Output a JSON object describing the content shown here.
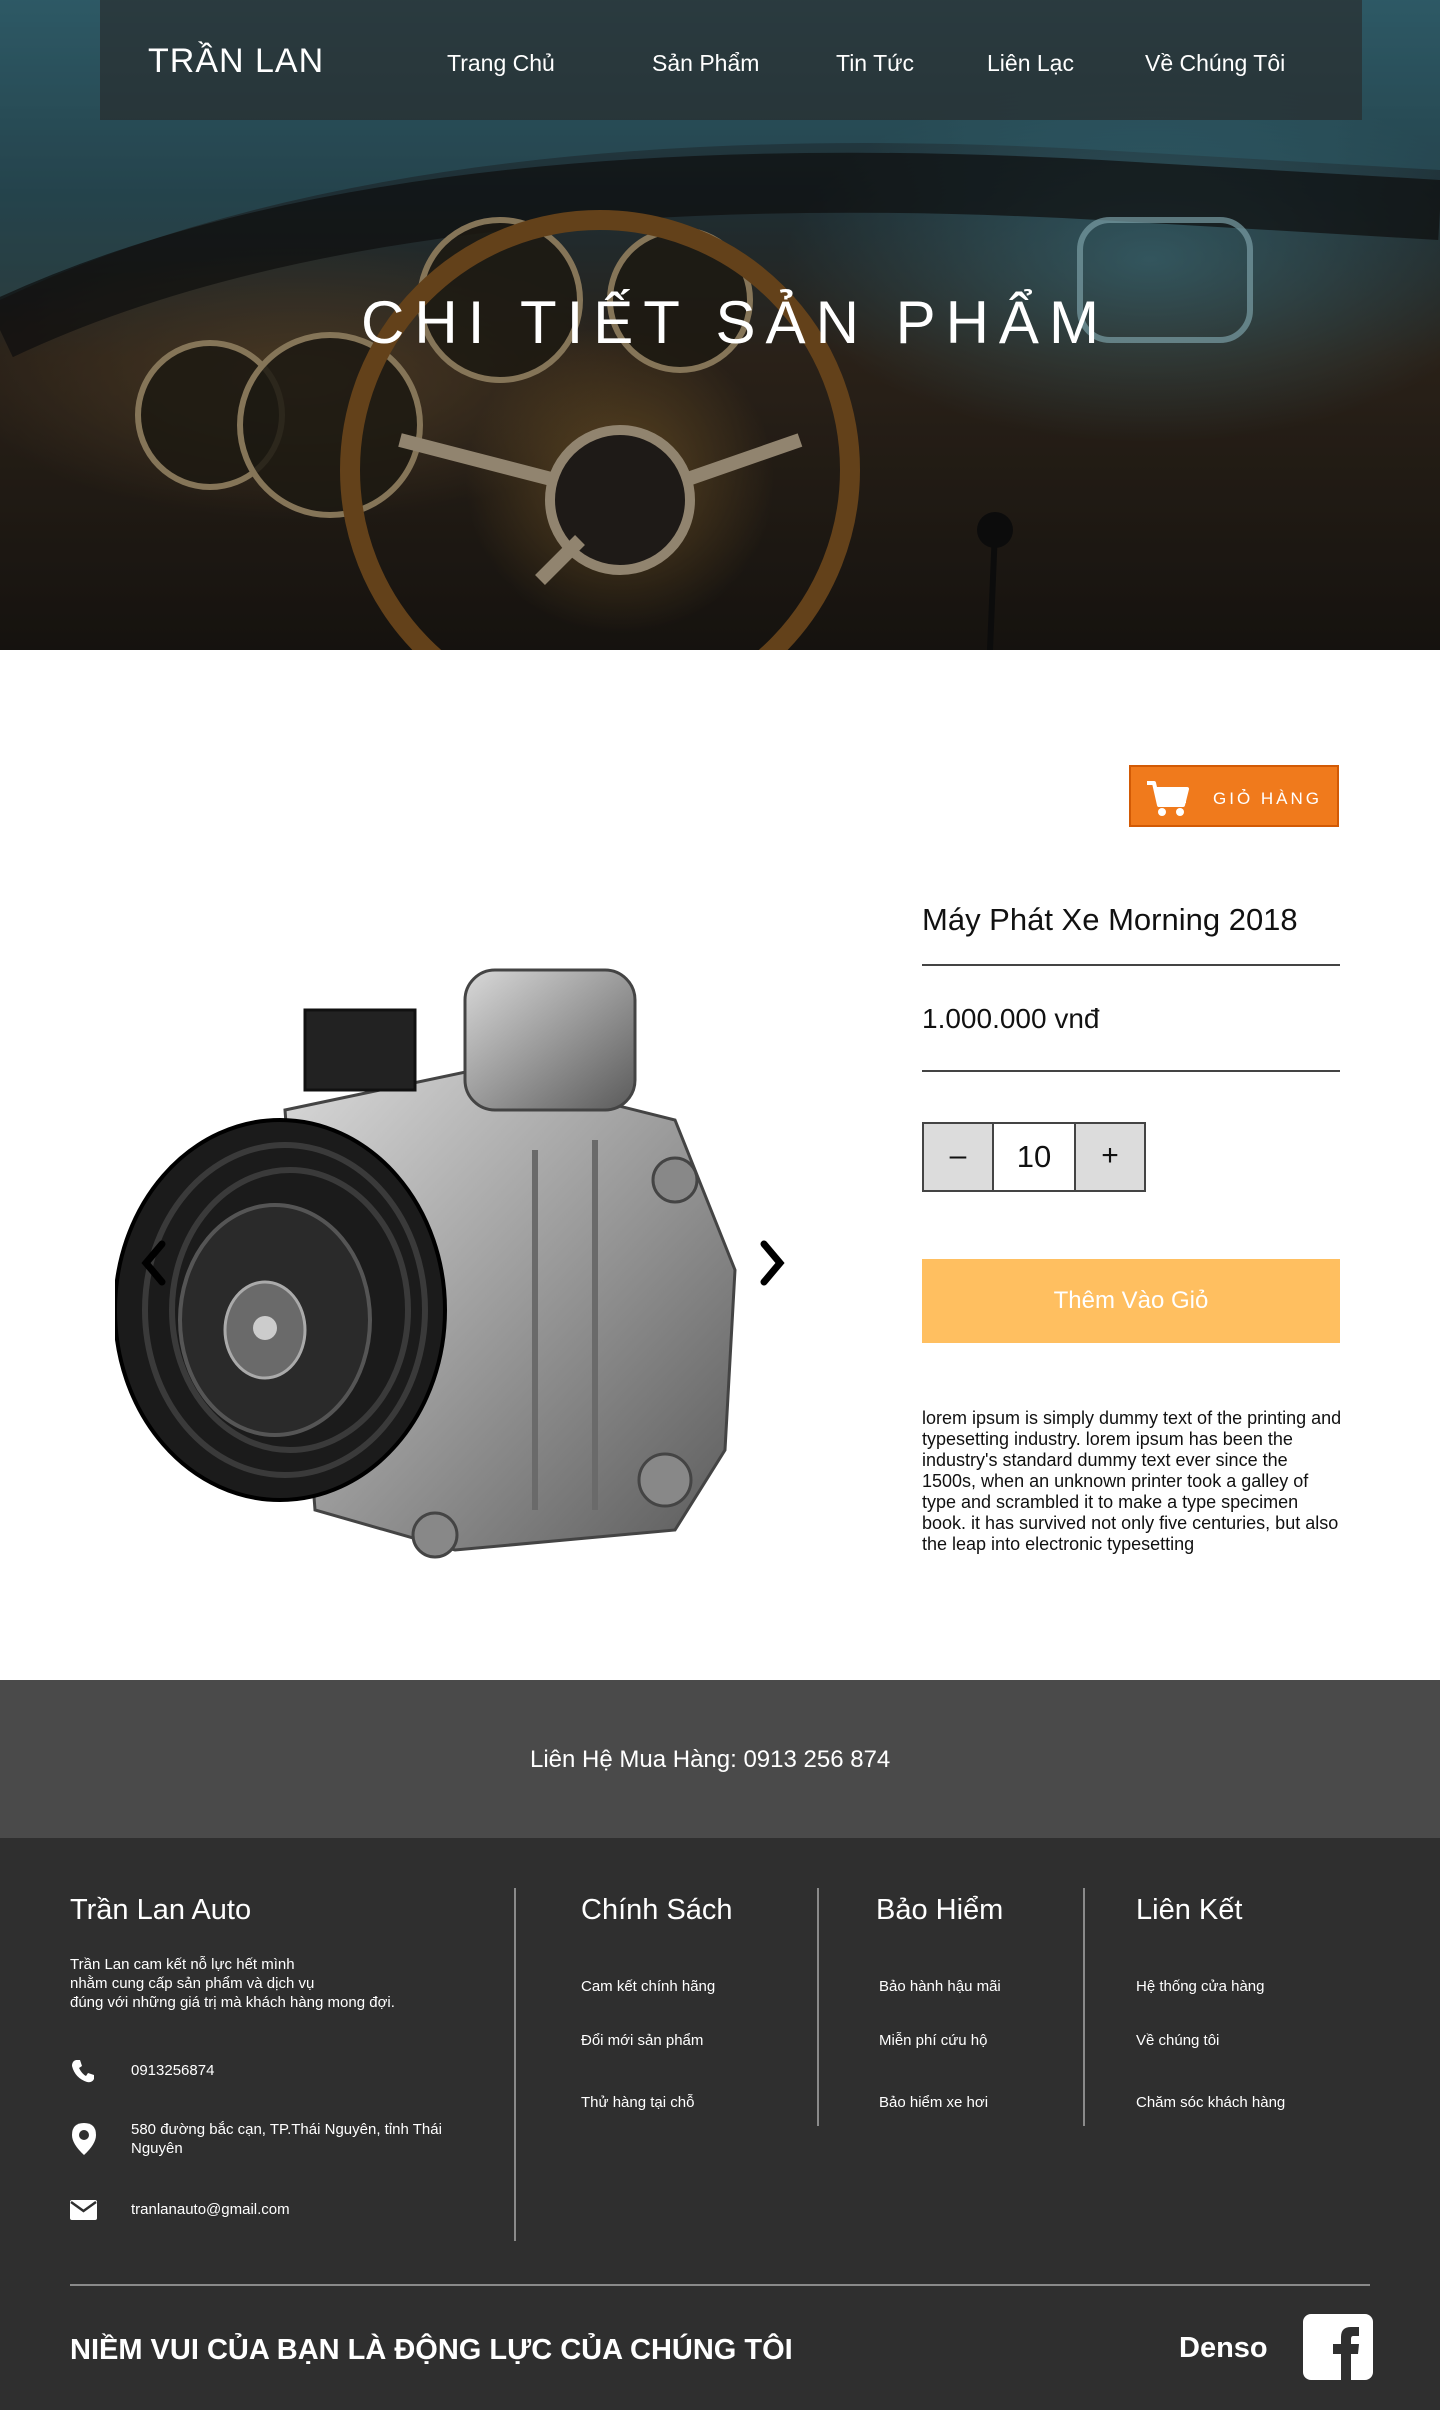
{
  "nav": {
    "brand": "TRẦN LAN",
    "items": [
      {
        "label": "Trang Chủ"
      },
      {
        "label": "Sản Phẩm"
      },
      {
        "label": "Tin Tức"
      },
      {
        "label": "Liên Lạc"
      },
      {
        "label": "Về Chúng Tôi"
      }
    ]
  },
  "hero": {
    "title": "CHI TIẾT SẢN PHẨM"
  },
  "cart": {
    "label": "GIỎ HÀNG",
    "icon": "cart-icon"
  },
  "product": {
    "name": "Máy Phát Xe Morning 2018",
    "price": "1.000.000 vnđ",
    "quantity": "10",
    "decrement": "–",
    "increment": "+",
    "add_to_cart": "Thêm Vào Giỏ",
    "description": "lorem ipsum is simply dummy text of the printing and typesetting industry. lorem ipsum has been the industry's standard dummy text ever since the 1500s, when an unknown printer took a galley of type and scrambled it to make a type specimen book. it has survived not only five centuries, but also the leap into electronic typesetting",
    "icons": [
      "chevron-left-icon",
      "chevron-right-icon"
    ]
  },
  "contact_strip": {
    "text": "Liên Hệ Mua Hàng:  0913 256 874"
  },
  "footer": {
    "about": {
      "title": "Trần Lan Auto",
      "lines": [
        "Trần Lan cam kết nỗ lực hết mình",
        "nhằm cung cấp sản phẩm và dịch vụ",
        "đúng với những giá trị mà khách hàng mong đợi."
      ],
      "phone": "0913256874",
      "address": "580 đường bắc cạn, TP.Thái Nguyên, tỉnh Thái Nguyên",
      "email": "tranlanauto@gmail.com"
    },
    "policy": {
      "title": "Chính Sách",
      "links": [
        "Cam kết chính hãng",
        "Đổi mới sản phẩm",
        "Thử hàng tại chỗ"
      ]
    },
    "insurance": {
      "title": "Bảo Hiểm",
      "links": [
        "Bảo hành hậu mãi",
        "Miễn phí cứu hộ",
        "Bảo hiểm xe hơi"
      ]
    },
    "links": {
      "title": "Liên Kết",
      "links": [
        "Hệ thống cửa hàng",
        "Về chúng tôi",
        "Chăm sóc khách hàng"
      ]
    },
    "slogan": "NIỀM VUI CỦA BẠN LÀ ĐỘNG LỰC CỦA CHÚNG TÔI",
    "partner": "Denso",
    "social_icon": "facebook-icon"
  },
  "colors": {
    "accent_orange": "#f07a1c",
    "add_button": "#ffbf60",
    "contact_strip": "#4a4a4a",
    "footer": "#2f2f2f"
  }
}
